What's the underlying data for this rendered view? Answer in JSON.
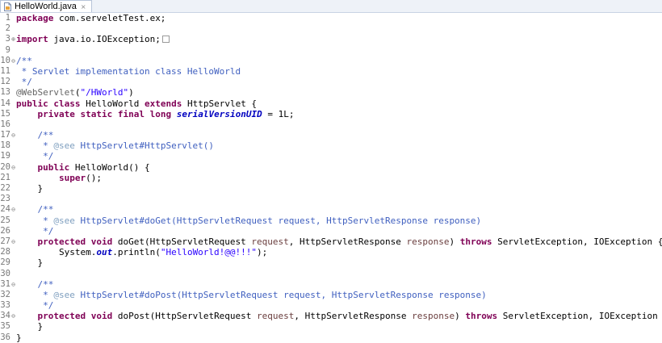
{
  "tab": {
    "title": "HelloWorld.java",
    "close_icon": "×"
  },
  "lines": [
    {
      "n": "1",
      "tokens": [
        {
          "t": "package",
          "c": "kw"
        },
        {
          "t": " com.serveletTest.ex;",
          "c": "pl"
        }
      ]
    },
    {
      "n": "2",
      "tokens": []
    },
    {
      "n": "3",
      "marker": "⊕",
      "tokens": [
        {
          "t": "import",
          "c": "kw"
        },
        {
          "t": " java.io.IOException;",
          "c": "pl"
        }
      ],
      "fold": true
    },
    {
      "n": "9",
      "tokens": []
    },
    {
      "n": "10",
      "marker": "⊖",
      "tokens": [
        {
          "t": "/**",
          "c": "jd"
        }
      ]
    },
    {
      "n": "11",
      "tokens": [
        {
          "t": " * Servlet implementation class HelloWorld",
          "c": "jd"
        }
      ]
    },
    {
      "n": "12",
      "tokens": [
        {
          "t": " */",
          "c": "jd"
        }
      ]
    },
    {
      "n": "13",
      "tokens": [
        {
          "t": "@WebServlet",
          "c": "an"
        },
        {
          "t": "(",
          "c": "pl"
        },
        {
          "t": "\"/HWorld\"",
          "c": "st"
        },
        {
          "t": ")",
          "c": "pl"
        }
      ]
    },
    {
      "n": "14",
      "tokens": [
        {
          "t": "public",
          "c": "kw"
        },
        {
          "t": " ",
          "c": "pl"
        },
        {
          "t": "class",
          "c": "kw"
        },
        {
          "t": " HelloWorld ",
          "c": "pl"
        },
        {
          "t": "extends",
          "c": "kw"
        },
        {
          "t": " HttpServlet {",
          "c": "pl"
        }
      ]
    },
    {
      "n": "15",
      "tokens": [
        {
          "t": "    ",
          "c": "pl"
        },
        {
          "t": "private",
          "c": "kw"
        },
        {
          "t": " ",
          "c": "pl"
        },
        {
          "t": "static",
          "c": "kw"
        },
        {
          "t": " ",
          "c": "pl"
        },
        {
          "t": "final",
          "c": "kw"
        },
        {
          "t": " ",
          "c": "pl"
        },
        {
          "t": "long",
          "c": "kw"
        },
        {
          "t": " ",
          "c": "pl"
        },
        {
          "t": "serialVersionUID",
          "c": "fld"
        },
        {
          "t": " = 1L;",
          "c": "pl"
        }
      ]
    },
    {
      "n": "16",
      "tokens": []
    },
    {
      "n": "17",
      "marker": "⊖",
      "tokens": [
        {
          "t": "    /**",
          "c": "jd"
        }
      ]
    },
    {
      "n": "18",
      "tokens": [
        {
          "t": "     * ",
          "c": "jd"
        },
        {
          "t": "@see",
          "c": "jt"
        },
        {
          "t": " HttpServlet#HttpServlet()",
          "c": "jd"
        }
      ]
    },
    {
      "n": "19",
      "tokens": [
        {
          "t": "     */",
          "c": "jd"
        }
      ]
    },
    {
      "n": "20",
      "marker": "⊖",
      "tokens": [
        {
          "t": "    ",
          "c": "pl"
        },
        {
          "t": "public",
          "c": "kw"
        },
        {
          "t": " HelloWorld() {",
          "c": "pl"
        }
      ]
    },
    {
      "n": "21",
      "tokens": [
        {
          "t": "        ",
          "c": "pl"
        },
        {
          "t": "super",
          "c": "kw"
        },
        {
          "t": "();",
          "c": "pl"
        }
      ]
    },
    {
      "n": "22",
      "tokens": [
        {
          "t": "    }",
          "c": "pl"
        }
      ]
    },
    {
      "n": "23",
      "tokens": []
    },
    {
      "n": "24",
      "marker": "⊖",
      "tokens": [
        {
          "t": "    /**",
          "c": "jd"
        }
      ]
    },
    {
      "n": "25",
      "tokens": [
        {
          "t": "     * ",
          "c": "jd"
        },
        {
          "t": "@see",
          "c": "jt"
        },
        {
          "t": " HttpServlet#doGet(HttpServletRequest request, HttpServletResponse response)",
          "c": "jd"
        }
      ]
    },
    {
      "n": "26",
      "tokens": [
        {
          "t": "     */",
          "c": "jd"
        }
      ]
    },
    {
      "n": "27",
      "marker": "⊖",
      "tokens": [
        {
          "t": "    ",
          "c": "pl"
        },
        {
          "t": "protected",
          "c": "kw"
        },
        {
          "t": " ",
          "c": "pl"
        },
        {
          "t": "void",
          "c": "kw"
        },
        {
          "t": " doGet(HttpServletRequest ",
          "c": "pl"
        },
        {
          "t": "request",
          "c": "par"
        },
        {
          "t": ", HttpServletResponse ",
          "c": "pl"
        },
        {
          "t": "response",
          "c": "par"
        },
        {
          "t": ") ",
          "c": "pl"
        },
        {
          "t": "throws",
          "c": "kw"
        },
        {
          "t": " ServletException, IOException {",
          "c": "pl"
        }
      ]
    },
    {
      "n": "28",
      "tokens": [
        {
          "t": "        System.",
          "c": "pl"
        },
        {
          "t": "out",
          "c": "fld"
        },
        {
          "t": ".println(",
          "c": "pl"
        },
        {
          "t": "\"HelloWorld!@@!!!\"",
          "c": "st"
        },
        {
          "t": ");",
          "c": "pl"
        }
      ]
    },
    {
      "n": "29",
      "tokens": [
        {
          "t": "    }",
          "c": "pl"
        }
      ]
    },
    {
      "n": "30",
      "tokens": []
    },
    {
      "n": "31",
      "marker": "⊖",
      "tokens": [
        {
          "t": "    /**",
          "c": "jd"
        }
      ]
    },
    {
      "n": "32",
      "tokens": [
        {
          "t": "     * ",
          "c": "jd"
        },
        {
          "t": "@see",
          "c": "jt"
        },
        {
          "t": " HttpServlet#doPost(HttpServletRequest request, HttpServletResponse response)",
          "c": "jd"
        }
      ]
    },
    {
      "n": "33",
      "tokens": [
        {
          "t": "     */",
          "c": "jd"
        }
      ]
    },
    {
      "n": "34",
      "marker": "⊖",
      "tokens": [
        {
          "t": "    ",
          "c": "pl"
        },
        {
          "t": "protected",
          "c": "kw"
        },
        {
          "t": " ",
          "c": "pl"
        },
        {
          "t": "void",
          "c": "kw"
        },
        {
          "t": " doPost(HttpServletRequest ",
          "c": "pl"
        },
        {
          "t": "request",
          "c": "par"
        },
        {
          "t": ", HttpServletResponse ",
          "c": "pl"
        },
        {
          "t": "response",
          "c": "par"
        },
        {
          "t": ") ",
          "c": "pl"
        },
        {
          "t": "throws",
          "c": "kw"
        },
        {
          "t": " ServletException, IOException {",
          "c": "pl"
        }
      ]
    },
    {
      "n": "35",
      "tokens": [
        {
          "t": "    }",
          "c": "pl"
        }
      ]
    },
    {
      "n": "36",
      "tokens": [
        {
          "t": "}",
          "c": "pl"
        }
      ]
    }
  ]
}
